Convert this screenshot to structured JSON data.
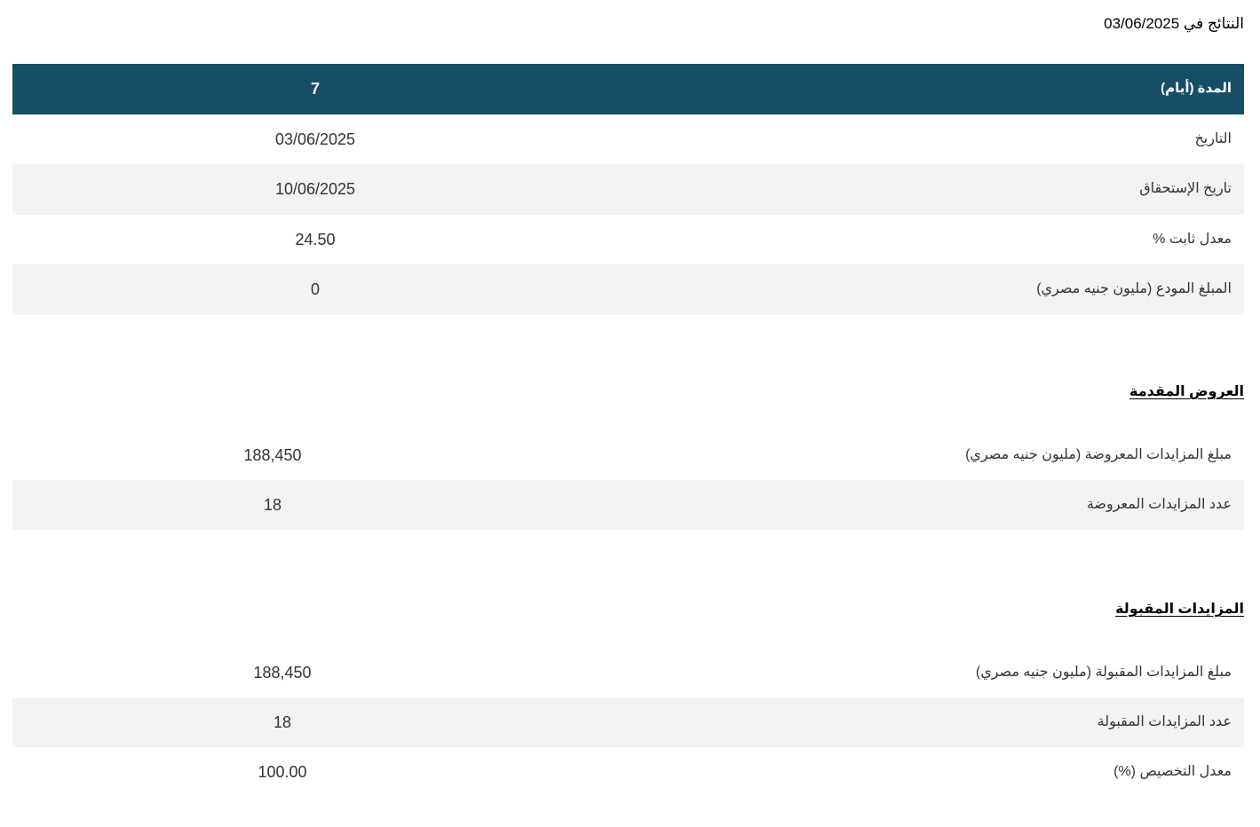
{
  "results_title": "النتائج في 03/06/2025",
  "summary": {
    "header": {
      "label": "المدة (أيام)",
      "value": "7"
    },
    "rows": [
      {
        "label": "التاريخ",
        "value": "03/06/2025"
      },
      {
        "label": "تاريخ الإستحقاق",
        "value": "10/06/2025"
      },
      {
        "label": "معدل ثابت %",
        "value": "24.50"
      },
      {
        "label": "المبلغ المودع (مليون جنيه مصري)",
        "value": "0"
      }
    ]
  },
  "offers": {
    "heading": "العروض المقدمة",
    "rows": [
      {
        "label": "مبلغ المزايدات المعروضة (مليون جنيه مصري)",
        "value": "188,450"
      },
      {
        "label": "عدد المزايدات المعروضة",
        "value": "18"
      }
    ]
  },
  "accepted": {
    "heading": "المزايدات المقبولة",
    "rows": [
      {
        "label": "مبلغ المزايدات المقبولة (مليون جنيه مصري)",
        "value": "188,450"
      },
      {
        "label": "عدد المزايدات المقبولة",
        "value": "18"
      },
      {
        "label": "معدل التخصيص (%)",
        "value": "100.00"
      }
    ]
  },
  "colors": {
    "header_bg": "#164e68",
    "alt_row_bg": "#f2f3f4",
    "text": "#333333"
  }
}
